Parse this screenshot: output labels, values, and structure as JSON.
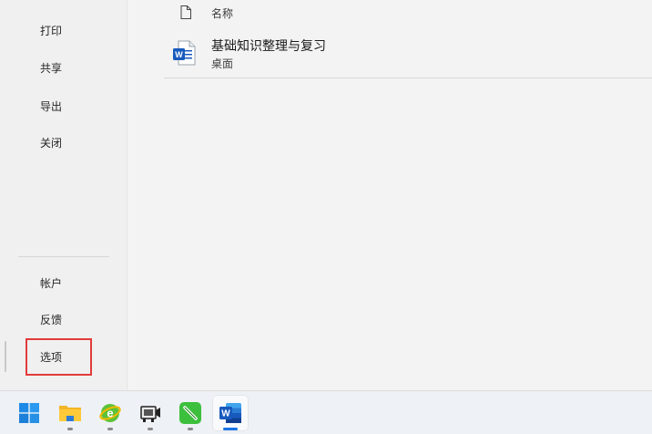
{
  "nav": {
    "items": [
      {
        "label": "打印"
      },
      {
        "label": "共享"
      },
      {
        "label": "导出"
      },
      {
        "label": "关闭"
      }
    ],
    "bottom_items": [
      {
        "label": "帐户"
      },
      {
        "label": "反馈"
      },
      {
        "label": "选项"
      }
    ]
  },
  "file_list": {
    "header_name": "名称",
    "files": [
      {
        "title": "基础知识整理与复习",
        "location": "桌面",
        "icon": "word-doc-icon"
      }
    ]
  },
  "taskbar": {
    "apps": [
      {
        "icon": "windows-start-icon"
      },
      {
        "icon": "file-explorer-icon"
      },
      {
        "icon": "browser-e-icon"
      },
      {
        "icon": "recorder-app-icon"
      },
      {
        "icon": "green-pen-app-icon"
      },
      {
        "icon": "word-app-icon"
      }
    ]
  },
  "colors": {
    "accent_highlight": "#e23b3b",
    "word_blue": "#185abd",
    "taskbar_active": "#1a73e8"
  }
}
